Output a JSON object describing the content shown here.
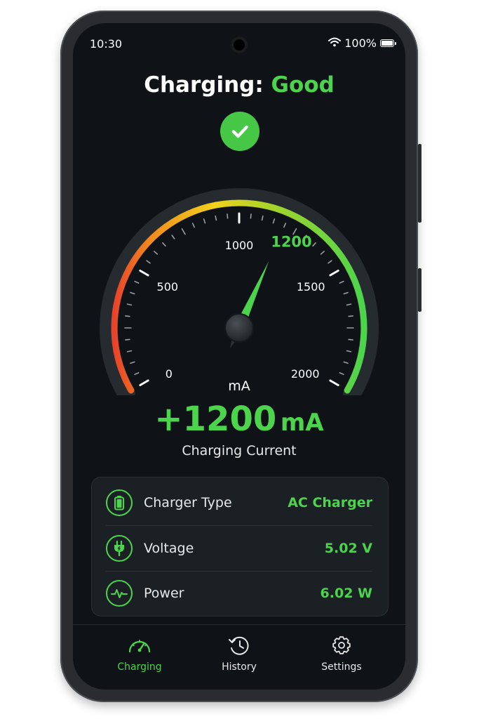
{
  "status_bar": {
    "time": "10:30",
    "battery": "100%"
  },
  "header": {
    "prefix": "Charging:",
    "status": "Good"
  },
  "gauge": {
    "unit": "mA",
    "value": 1200,
    "value_label": "1200",
    "min": 0,
    "max": 2000,
    "tick_labels": [
      "0",
      "500",
      "1000",
      "1500",
      "2000"
    ],
    "colors": {
      "low": "#e8432a",
      "mid": "#f2d21b",
      "high": "#4cd44c",
      "needle": "#4cd44c"
    }
  },
  "reading": {
    "value": "+1200",
    "unit": "mA",
    "label": "Charging Current"
  },
  "details": [
    {
      "icon": "battery-icon",
      "label": "Charger Type",
      "value": "AC Charger"
    },
    {
      "icon": "plug-icon",
      "label": "Voltage",
      "value": "5.02 V"
    },
    {
      "icon": "pulse-icon",
      "label": "Power",
      "value": "6.02 W"
    }
  ],
  "nav": [
    {
      "icon": "speedometer-icon",
      "label": "Charging",
      "active": true
    },
    {
      "icon": "history-icon",
      "label": "History",
      "active": false
    },
    {
      "icon": "gear-icon",
      "label": "Settings",
      "active": false
    }
  ],
  "accent": "#4cd44c"
}
